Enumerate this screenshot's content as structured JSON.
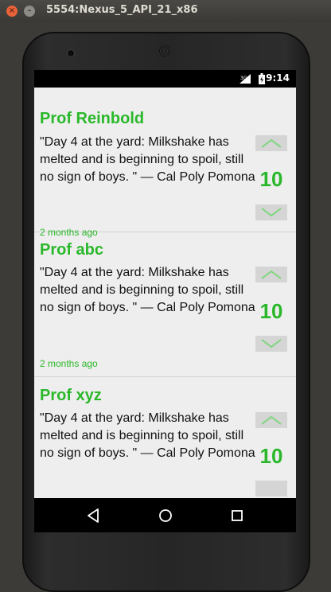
{
  "window": {
    "title": "5554:Nexus_5_API_21_x86"
  },
  "statusbar": {
    "time": "9:14",
    "network": "3G"
  },
  "posts": [
    {
      "name": "Prof Reinbold",
      "quote": "\"Day 4 at the yard: Milkshake has melted and is beginning to spoil, still no sign of boys. \" — Cal Poly Pomona",
      "votes": "10",
      "time": "2 months ago"
    },
    {
      "name": "Prof abc",
      "quote": "\"Day 4 at the yard: Milkshake has melted and is beginning to spoil, still no sign of boys. \" — Cal Poly Pomona",
      "votes": "10",
      "time": "2 months ago"
    },
    {
      "name": "Prof xyz",
      "quote": "\"Day 4 at the yard: Milkshake has melted and is beginning to spoil, still no sign of boys. \" — Cal Poly Pomona",
      "votes": "10",
      "time": ""
    }
  ],
  "colors": {
    "accent": "#2ab82a",
    "content_bg": "#eeeeee",
    "vote_bg": "#d5d5d5"
  },
  "icons": {
    "up": "chevron-up-icon",
    "down": "chevron-down-icon",
    "back": "back-triangle-icon",
    "home": "home-circle-icon",
    "recent": "recent-square-icon"
  }
}
